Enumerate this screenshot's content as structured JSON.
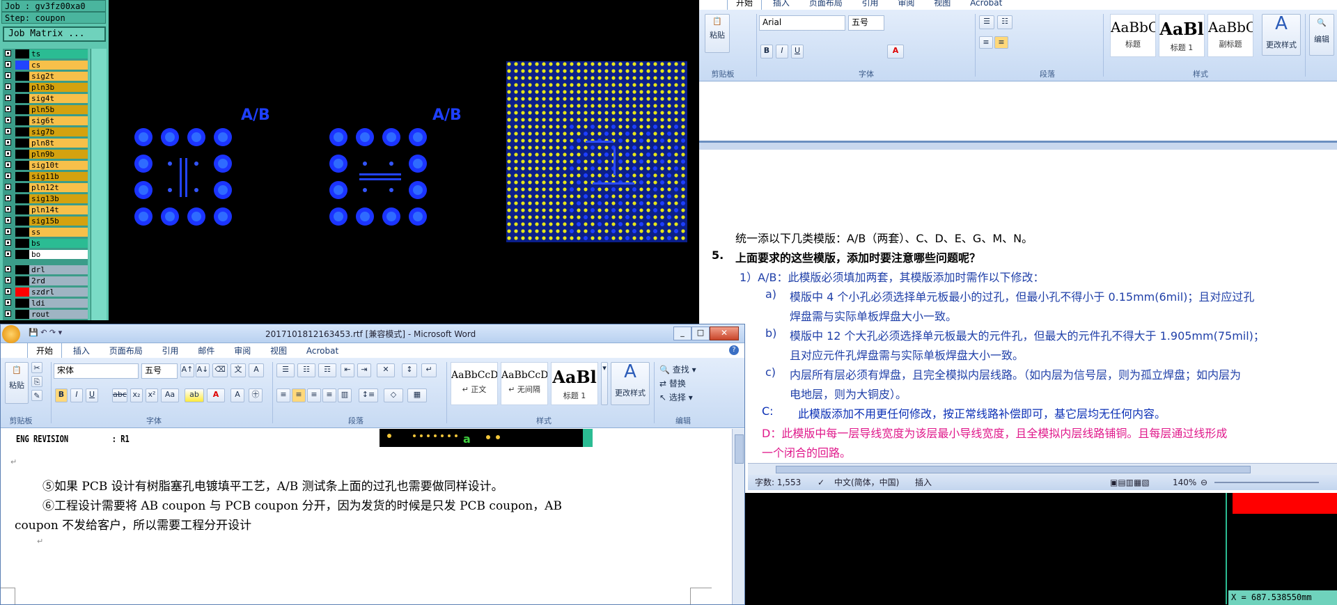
{
  "cam": {
    "job_label": "Job : gv3fz00xa0",
    "step_label": "Step: coupon",
    "job_matrix_button": "Job Matrix ...",
    "layers": [
      {
        "name": "ts",
        "color": "#2bbc93"
      },
      {
        "name": "cs",
        "color": "#f7c04a"
      },
      {
        "name": "sig2t",
        "color": "#f7c04a"
      },
      {
        "name": "pln3b",
        "color": "#d4a20f"
      },
      {
        "name": "sig4t",
        "color": "#f7c04a"
      },
      {
        "name": "pln5b",
        "color": "#d4a20f"
      },
      {
        "name": "sig6t",
        "color": "#f7c04a"
      },
      {
        "name": "sig7b",
        "color": "#d4a20f"
      },
      {
        "name": "pln8t",
        "color": "#f7c04a"
      },
      {
        "name": "pln9b",
        "color": "#d4a20f"
      },
      {
        "name": "sig10t",
        "color": "#f7c04a"
      },
      {
        "name": "sig11b",
        "color": "#d4a20f"
      },
      {
        "name": "pln12t",
        "color": "#f7c04a"
      },
      {
        "name": "sig13b",
        "color": "#d4a20f"
      },
      {
        "name": "pln14t",
        "color": "#f7c04a"
      },
      {
        "name": "sig15b",
        "color": "#d4a20f"
      },
      {
        "name": "ss",
        "color": "#f7c04a"
      },
      {
        "name": "bs",
        "color": "#2bbc93"
      },
      {
        "name": "bo",
        "color": "#ffffff"
      },
      {
        "name": "drl",
        "color": "#9fb4c3"
      },
      {
        "name": "2rd",
        "color": "#9fb4c3"
      },
      {
        "name": "szdrl",
        "color": "#9fb4c3"
      },
      {
        "name": "ldi",
        "color": "#9fb4c3"
      },
      {
        "name": "rout",
        "color": "#9fb4c3"
      }
    ],
    "ab_label_1": "A/B",
    "ab_label_2": "A/B"
  },
  "word_back": {
    "tabs": [
      "开始",
      "插入",
      "页面布局",
      "引用",
      "审阅",
      "视图",
      "Acrobat"
    ],
    "font_name": "Arial",
    "font_size": "五号",
    "styles": [
      {
        "preview": "AaBbC(",
        "name": "标题"
      },
      {
        "preview": "AaBl",
        "name": "标题 1"
      },
      {
        "preview": "AaBbC(",
        "name": "副标题"
      }
    ],
    "change_styles": "更改样式",
    "edit": "编辑",
    "group_clipboard": "剪贴板",
    "group_font": "字体",
    "group_paragraph": "段落",
    "group_styles": "样式",
    "paste": "粘贴",
    "lines": [
      "统一添以下几类模版：A/B（两套）、C、D、E、G、M、N。",
      "5.",
      "上面要求的这些模版，添加时要注意哪些问题呢？",
      "1）A/B：此模版必须填加两套，其模版添加时需作以下修改：",
      "a)",
      "模版中 4 个小孔必须选择单元板最小的过孔，但最小孔不得小于 0.15mm(6mil)；且对应过孔",
      "焊盘需与实际单板焊盘大小一致。",
      "b)",
      "模版中 12 个大孔必须选择单元板最大的元件孔，但最大的元件孔不得大于 1.905mm(75mil)；",
      "且对应元件孔焊盘需与实际单板焊盘大小一致。",
      "c)",
      "内层所有层必须有焊盘，且完全模拟内层线路。（如内层为信号层，则为孤立焊盘；如内层为",
      "电地层，则为大铜皮）。",
      "C:",
      "此模版添加不用更任何修改，按正常线路补偿即可，基它层均无任何内容。",
      "D：此模版中每一层导线宽度为该层最小导线宽度，且全模拟内层线路铺铜。且每层通过线形成",
      "一个闭合的回路。"
    ],
    "status_words": "字数: 1,553",
    "status_lang": "中文(简体，中国)",
    "status_mode": "插入",
    "zoom": "140%",
    "coord_readout": "X = 687.538550mm"
  },
  "word_front": {
    "title": "20171018121634​53.rtf [兼容模式] - Microsoft Word",
    "tabs": [
      "开始",
      "插入",
      "页面布局",
      "引用",
      "邮件",
      "审阅",
      "视图",
      "Acrobat"
    ],
    "font_name": "宋体",
    "font_size": "五号",
    "styles": [
      {
        "preview": "AaBbCcD(",
        "name": "↵ 正文"
      },
      {
        "preview": "AaBbCcD(",
        "name": "↵ 无间隔"
      },
      {
        "preview": "AaBl",
        "name": "标题 1"
      }
    ],
    "change_styles": "更改样式",
    "find": "查找",
    "replace": "替换",
    "select": "选择",
    "group_clipboard": "剪贴板",
    "group_font": "字体",
    "group_paragraph": "段落",
    "group_styles": "样式",
    "group_edit": "编辑",
    "paste": "粘贴",
    "eng_revision": "ENG REVISION          : R1",
    "para_5": "⑤如果 PCB 设计有树脂塞孔电镀填平工艺，A/B 测试条上面的过孔也需要做同样设计。",
    "para_6a": "⑥工程设计需要将 AB coupon  与  PCB coupon  分开，因为发货的时候是只发 PCB coupon，AB",
    "para_6b": "coupon 不发给客户，所以需要工程分开设计"
  }
}
